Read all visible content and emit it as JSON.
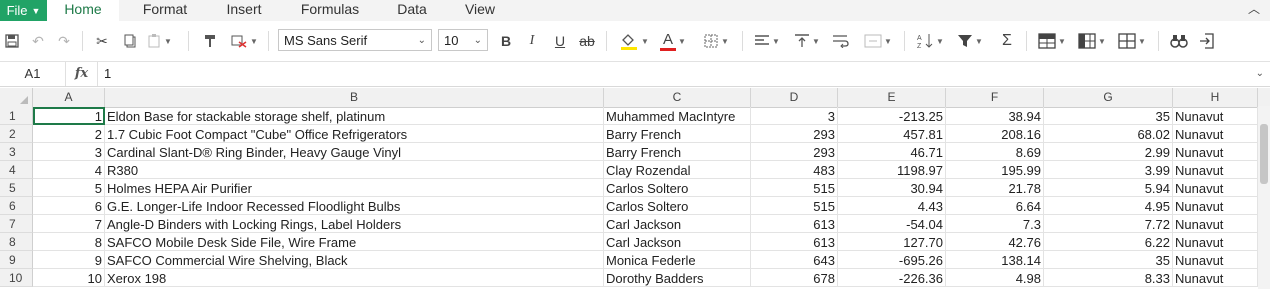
{
  "menu": {
    "file_label": "File",
    "tabs": [
      "Home",
      "Format",
      "Insert",
      "Formulas",
      "Data",
      "View"
    ],
    "active_tab": "Home"
  },
  "toolbar": {
    "font_name": "MS Sans Serif",
    "font_size": "10",
    "bold": "B",
    "italic": "I",
    "underline": "U",
    "strikethrough": "ab",
    "font_color_glyph": "A",
    "sum_glyph": "Σ",
    "accent_color": "#21a366",
    "font_color_bar": "#e02020",
    "fill_color_bar": "#ffe600"
  },
  "formula_bar": {
    "cell_ref": "A1",
    "fx": "fx",
    "value": "1"
  },
  "columns": [
    "A",
    "B",
    "C",
    "D",
    "E",
    "F",
    "G",
    "H"
  ],
  "rows": [
    {
      "n": "1",
      "a": "1",
      "b": "Eldon Base for stackable storage shelf, platinum",
      "c": "Muhammed MacIntyre",
      "d": "3",
      "e": "-213.25",
      "f": "38.94",
      "g": "35",
      "h": "Nunavut"
    },
    {
      "n": "2",
      "a": "2",
      "b": "1.7 Cubic Foot Compact \"Cube\" Office Refrigerators",
      "c": "Barry French",
      "d": "293",
      "e": "457.81",
      "f": "208.16",
      "g": "68.02",
      "h": "Nunavut"
    },
    {
      "n": "3",
      "a": "3",
      "b": "Cardinal Slant-D® Ring Binder, Heavy Gauge Vinyl",
      "c": "Barry French",
      "d": "293",
      "e": "46.71",
      "f": "8.69",
      "g": "2.99",
      "h": "Nunavut"
    },
    {
      "n": "4",
      "a": "4",
      "b": "R380",
      "c": "Clay Rozendal",
      "d": "483",
      "e": "1198.97",
      "f": "195.99",
      "g": "3.99",
      "h": "Nunavut"
    },
    {
      "n": "5",
      "a": "5",
      "b": "Holmes HEPA Air Purifier",
      "c": "Carlos Soltero",
      "d": "515",
      "e": "30.94",
      "f": "21.78",
      "g": "5.94",
      "h": "Nunavut"
    },
    {
      "n": "6",
      "a": "6",
      "b": "G.E. Longer-Life Indoor Recessed Floodlight Bulbs",
      "c": "Carlos Soltero",
      "d": "515",
      "e": "4.43",
      "f": "6.64",
      "g": "4.95",
      "h": "Nunavut"
    },
    {
      "n": "7",
      "a": "7",
      "b": "Angle-D Binders with Locking Rings, Label Holders",
      "c": "Carl Jackson",
      "d": "613",
      "e": "-54.04",
      "f": "7.3",
      "g": "7.72",
      "h": "Nunavut"
    },
    {
      "n": "8",
      "a": "8",
      "b": "SAFCO Mobile Desk Side File, Wire Frame",
      "c": "Carl Jackson",
      "d": "613",
      "e": "127.70",
      "f": "42.76",
      "g": "6.22",
      "h": "Nunavut"
    },
    {
      "n": "9",
      "a": "9",
      "b": "SAFCO Commercial Wire Shelving, Black",
      "c": "Monica Federle",
      "d": "643",
      "e": "-695.26",
      "f": "138.14",
      "g": "35",
      "h": "Nunavut"
    },
    {
      "n": "10",
      "a": "10",
      "b": "Xerox 198",
      "c": "Dorothy Badders",
      "d": "678",
      "e": "-226.36",
      "f": "4.98",
      "g": "8.33",
      "h": "Nunavut"
    }
  ]
}
